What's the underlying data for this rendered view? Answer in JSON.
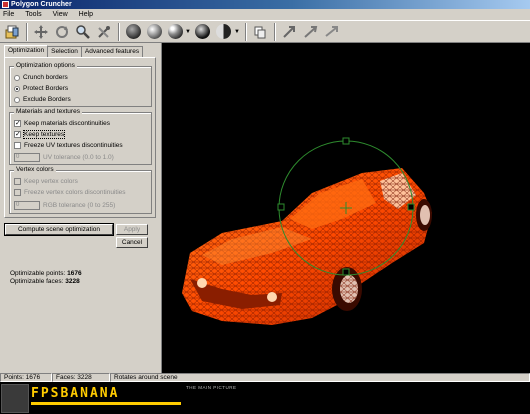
{
  "window": {
    "title": "Polygon Cruncher"
  },
  "menu": [
    "File",
    "Tools",
    "View",
    "Help"
  ],
  "toolbar": {
    "icons": [
      "file-icon",
      "pan-icon",
      "rotate-icon",
      "zoom-icon",
      "tools-icon",
      "shade-flat-icon",
      "shade-smooth-icon",
      "shade-highlight-icon",
      "shade-dark-icon",
      "shade-half-icon",
      "copy-icon",
      "arrow-diagonal-icon",
      "arrow-right-icon",
      "arrow-left-icon"
    ]
  },
  "tabs": [
    "Optimization",
    "Selection",
    "Advanced features"
  ],
  "optimization_options": {
    "title": "Optimization options",
    "options": [
      "Crunch borders",
      "Protect Borders",
      "Exclude Borders"
    ],
    "selected": "Protect Borders"
  },
  "materials": {
    "title": "Materials and textures",
    "keep_materials": "Keep materials discontinuities",
    "keep_textures": "Keep textures",
    "freeze_uv": "Freeze UV textures discontinuities",
    "uv_value": "0",
    "uv_label": "UV tolerance (0.0 to 1.0)"
  },
  "vertex_colors": {
    "title": "Vertex colors",
    "keep_vertex": "Keep vertex colors",
    "freeze_vertex": "Freeze vertex colors discontinuities",
    "rgb_value": "0",
    "rgb_label": "RGB tolerance (0 to 255)"
  },
  "buttons": {
    "compute": "Compute scene optimization",
    "apply": "Apply",
    "cancel": "Cancel"
  },
  "stats": {
    "points_label": "Optimizable points:",
    "points_value": "1676",
    "faces_label": "Optimizable faces:",
    "faces_value": "3228"
  },
  "status": {
    "points": "Points: 1676",
    "faces": "Faces: 3228",
    "mode": "Rotates around scene"
  },
  "banner": {
    "logo": "FPSBANANA",
    "caption": "THE MAIN PICTURE"
  },
  "colors": {
    "titlebar": "#0a246a",
    "car": "#ff5a00",
    "wire": "#8a1a00",
    "gizmo": "#2e8b2e",
    "logo": "#ffcc00"
  }
}
